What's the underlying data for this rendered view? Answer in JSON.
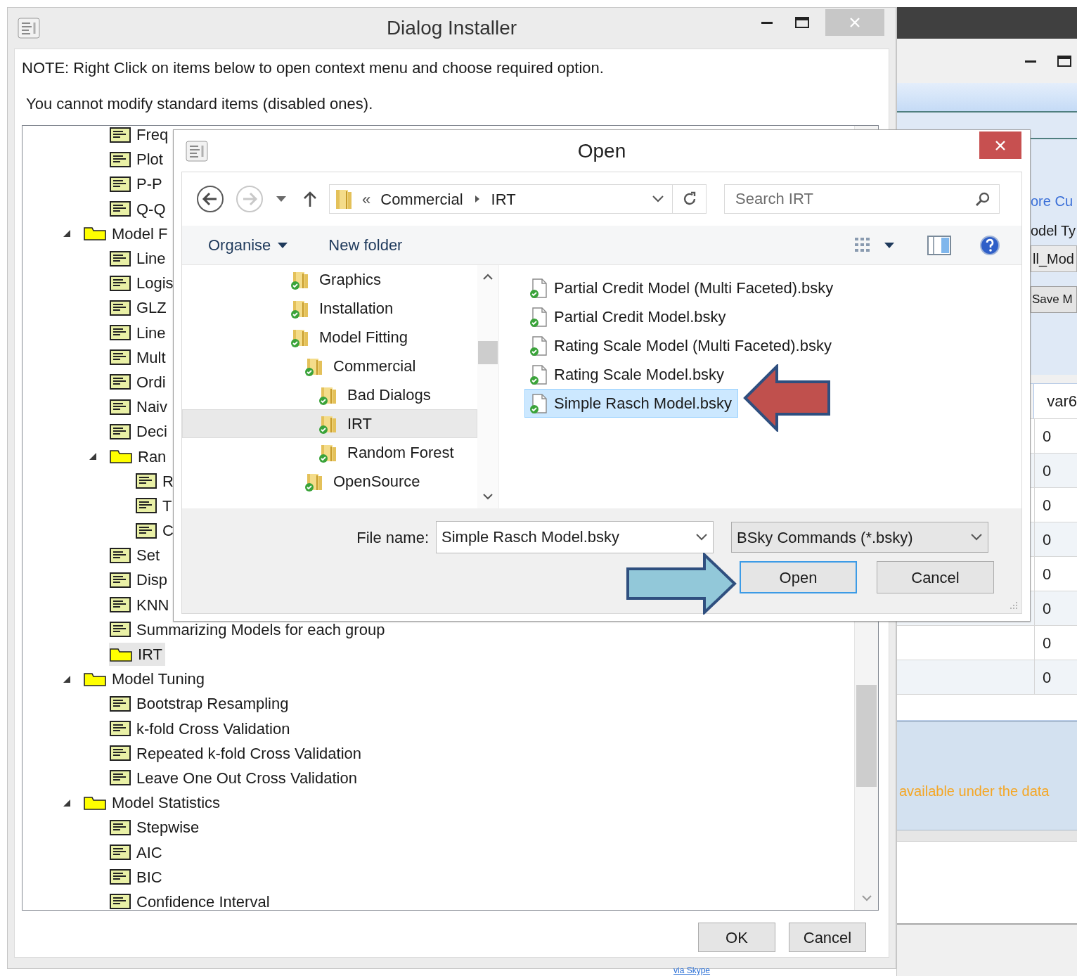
{
  "installer": {
    "title": "Dialog Installer",
    "note": "NOTE: Right Click on items below to open context menu and choose required option.",
    "hint": "You cannot modify standard items (disabled ones).",
    "tree": {
      "continued_items": [
        {
          "kind": "dialog",
          "label": "Freq",
          "selected": false
        },
        {
          "kind": "dialog",
          "label": "Plot",
          "selected": false
        },
        {
          "kind": "dialog",
          "label": "P-P",
          "selected": false
        },
        {
          "kind": "dialog",
          "label": "Q-Q",
          "selected": false
        }
      ],
      "items": [
        {
          "kind": "folder",
          "label": "Model F",
          "expanded": true,
          "selected": false,
          "children": [
            {
              "kind": "dialog",
              "label": "Line",
              "selected": false
            },
            {
              "kind": "dialog",
              "label": "Logis",
              "selected": false
            },
            {
              "kind": "dialog",
              "label": "GLZ",
              "selected": false
            },
            {
              "kind": "dialog",
              "label": "Line",
              "selected": false
            },
            {
              "kind": "dialog",
              "label": "Mult",
              "selected": false
            },
            {
              "kind": "dialog",
              "label": "Ordi",
              "selected": false
            },
            {
              "kind": "dialog",
              "label": "Naiv",
              "selected": false
            },
            {
              "kind": "dialog",
              "label": "Deci",
              "selected": false
            },
            {
              "kind": "folder",
              "label": "Ran",
              "expanded": true,
              "selected": false,
              "children": [
                {
                  "kind": "dialog",
                  "label": "R",
                  "selected": false
                },
                {
                  "kind": "dialog",
                  "label": "T",
                  "selected": false
                },
                {
                  "kind": "dialog",
                  "label": "C",
                  "selected": false
                }
              ]
            },
            {
              "kind": "dialog",
              "label": "Set",
              "selected": false
            },
            {
              "kind": "dialog",
              "label": "Disp",
              "selected": false
            },
            {
              "kind": "dialog",
              "label": "KNN",
              "selected": false
            },
            {
              "kind": "dialog",
              "label": "Summarizing Models for each group",
              "selected": false
            },
            {
              "kind": "folder",
              "label": "IRT",
              "selected": true
            }
          ]
        },
        {
          "kind": "folder",
          "label": "Model Tuning",
          "expanded": true,
          "selected": false,
          "children": [
            {
              "kind": "dialog",
              "label": "Bootstrap Resampling",
              "selected": false
            },
            {
              "kind": "dialog",
              "label": "k-fold Cross Validation",
              "selected": false
            },
            {
              "kind": "dialog",
              "label": "Repeated k-fold Cross Validation",
              "selected": false
            },
            {
              "kind": "dialog",
              "label": "Leave One Out Cross Validation",
              "selected": false
            }
          ]
        },
        {
          "kind": "folder",
          "label": "Model Statistics",
          "expanded": true,
          "selected": false,
          "children": [
            {
              "kind": "dialog",
              "label": "Stepwise",
              "selected": false
            },
            {
              "kind": "dialog",
              "label": "AIC",
              "selected": false
            },
            {
              "kind": "dialog",
              "label": "BIC",
              "selected": false
            },
            {
              "kind": "dialog",
              "label": "Confidence Interval",
              "selected": false
            }
          ]
        }
      ]
    },
    "buttons": [
      "OK",
      "Cancel"
    ]
  },
  "open_dialog": {
    "title": "Open",
    "address": {
      "overflow_mark": "«",
      "path": [
        "Commercial",
        "IRT"
      ]
    },
    "search": {
      "placeholder": "Search IRT"
    },
    "toolbar": {
      "organise": "Organise",
      "new_folder": "New folder"
    },
    "nav_tree": [
      {
        "label": "Graphics",
        "selected": false
      },
      {
        "label": "Installation",
        "selected": false
      },
      {
        "label": "Model Fitting",
        "selected": false,
        "children": [
          {
            "label": "Commercial",
            "selected": false,
            "children": [
              {
                "label": "Bad Dialogs",
                "selected": false
              },
              {
                "label": "IRT",
                "selected": true
              },
              {
                "label": "Random Forest",
                "selected": false
              }
            ]
          },
          {
            "label": "OpenSource",
            "selected": false
          }
        ]
      }
    ],
    "files": [
      {
        "name": "Partial Credit Model (Multi Faceted).bsky",
        "selected": false
      },
      {
        "name": "Partial Credit Model.bsky",
        "selected": false
      },
      {
        "name": "Rating Scale Model (Multi Faceted).bsky",
        "selected": false
      },
      {
        "name": "Rating Scale Model.bsky",
        "selected": false
      },
      {
        "name": "Simple Rasch Model.bsky",
        "selected": true
      }
    ],
    "file_name": {
      "label": "File name:",
      "value": "Simple Rasch Model.bsky"
    },
    "file_type": "BSky Commands (*.bsky)",
    "buttons": [
      {
        "label": "Open",
        "default": true
      },
      {
        "label": "Cancel",
        "default": false
      }
    ]
  },
  "background_app": {
    "link": "ore Cu",
    "label": "odel Ty",
    "dropdown": "ll_Mod",
    "button": "Save M",
    "table": {
      "columns": [
        "var6"
      ],
      "rows": [
        [
          "0"
        ],
        [
          "0"
        ],
        [
          "0"
        ],
        [
          "0"
        ],
        [
          "0"
        ],
        [
          "0"
        ],
        [
          "0"
        ],
        [
          "0"
        ]
      ]
    },
    "notice": "available under the data",
    "footer_link": "via Skype"
  }
}
